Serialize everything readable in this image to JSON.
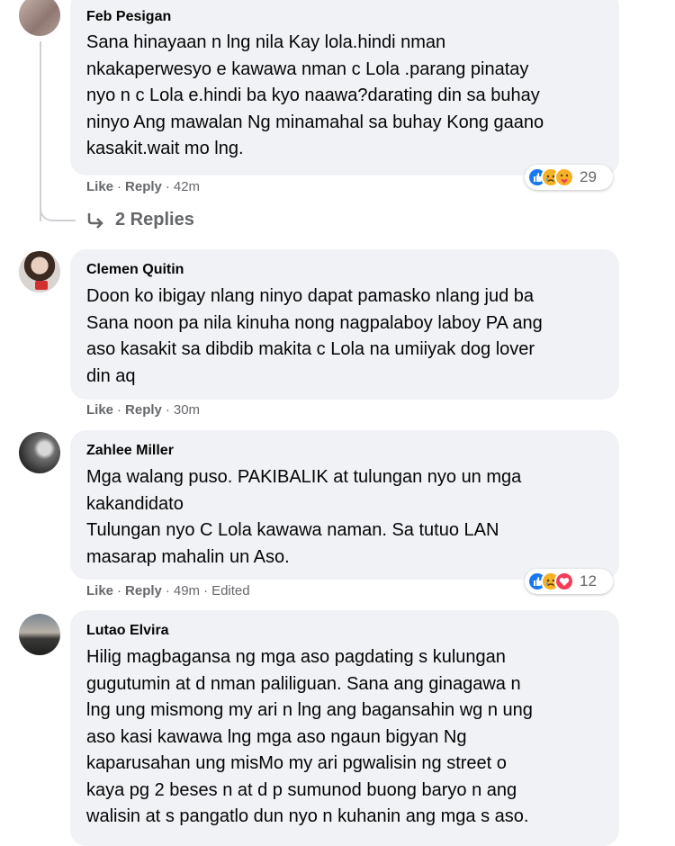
{
  "comments": [
    {
      "author": "Feb Pesigan",
      "text": "Sana hinayaan n lng nila Kay lola.hindi nman\nnkakaperwesyo e kawawa nman c Lola .parang pinatay\nnyo n c Lola e.hindi ba kyo naawa?darating din sa buhay\nninyo Ang mawalan Ng minamahal sa buhay Kong gaano\nkasakit.wait mo lng.",
      "like": "Like",
      "reply": "Reply",
      "time": "42m",
      "reactions": {
        "icons": [
          "like-icon",
          "sad-icon",
          "care-icon"
        ],
        "count": "29"
      },
      "replies_label": "2 Replies"
    },
    {
      "author": "Clemen Quitin",
      "text": "Doon ko ibigay nlang ninyo dapat pamasko nlang jud ba\nSana noon pa nila kinuha nong nagpalaboy laboy PA ang\naso kasakit sa dibdib makita c Lola na umiiyak dog lover\ndin aq",
      "like": "Like",
      "reply": "Reply",
      "time": "30m"
    },
    {
      "author": "Zahlee Miller",
      "text": "Mga walang puso. PAKIBALIK at tulungan nyo un mga\nkakandidato\nTulungan nyo C Lola kawawa naman. Sa tutuo LAN\nmasarap mahalin un Aso.",
      "like": "Like",
      "reply": "Reply",
      "time": "49m",
      "edited": "Edited",
      "reactions": {
        "icons": [
          "like-icon",
          "sad-icon",
          "love-icon"
        ],
        "count": "12"
      }
    },
    {
      "author": "Lutao Elvira",
      "text": "Hilig magbagansa ng mga aso pagdating s kulungan\ngugutumin at d nman paliliguan. Sana ang ginagawa n\nlng ung mismong my ari n lng ang bagansahin wg n ung\naso kasi kawawa lng mga aso ngaun bigyan Ng\nkaparusahan ung misMo my ari pgwalisin ng street o\nkaya pg 2 beses n at d p sumunod buong baryo n ang\nwalisin at s pangatlo dun nyo n kuhanin ang mga s aso."
    }
  ],
  "colors": {
    "bubble": "#f0f2f5",
    "meta": "#65676b",
    "like_blue": "#1877f2",
    "sad_yellow": "#f7b125",
    "love_red": "#f33e58"
  }
}
